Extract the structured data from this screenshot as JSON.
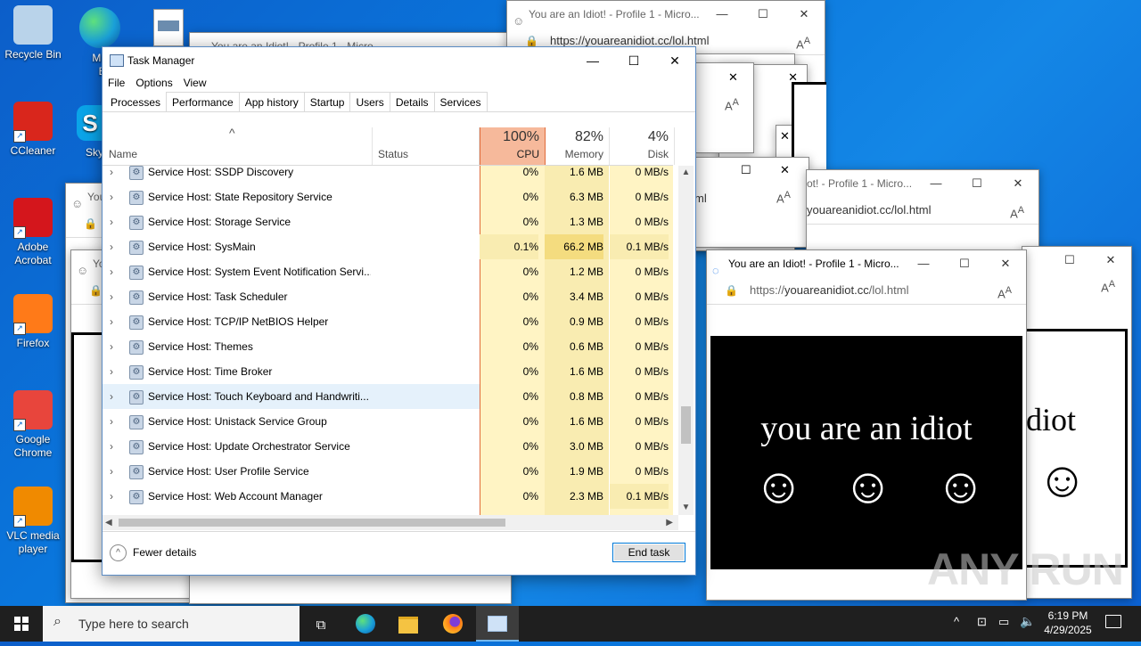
{
  "desktop": {
    "icons": [
      {
        "label": "Recycle Bin",
        "icon": "recycle-bin-icon",
        "color": "#b9d3ea"
      },
      {
        "label": "CCleaner",
        "icon": "ccleaner-icon",
        "color": "#d9261c"
      },
      {
        "label": "Adobe Acrobat",
        "icon": "adobe-acrobat-icon",
        "color": "#d4161c"
      },
      {
        "label": "Firefox",
        "icon": "firefox-icon",
        "color": "#ff7a18"
      },
      {
        "label": "Google Chrome",
        "icon": "chrome-icon",
        "color": "#e8453c"
      },
      {
        "label": "VLC media player",
        "icon": "vlc-icon",
        "color": "#f08a00"
      }
    ],
    "partial_icons": [
      {
        "label": "Micro Ed",
        "icon": "edge-icon"
      },
      {
        "label": "Sky",
        "icon": "skype-icon"
      }
    ]
  },
  "browser": {
    "title": "You are an Idiot! - Profile 1 - Micro...",
    "title_short": "You are an Idiot! - Profile 1 - Micro",
    "title_tail": "ot! - Profile 1 - Micro...",
    "url_prefix": "https://",
    "url_host": "youareanidiot.cc",
    "url_path": "/lol.html",
    "url_tail": "youareanidiot.cc/lol.html",
    "url_small": "ml",
    "heading": "you are an idiot",
    "heading_partial": "diot",
    "smiley": "☺"
  },
  "task_manager": {
    "title": "Task Manager",
    "menu": [
      "File",
      "Options",
      "View"
    ],
    "tabs": [
      "Processes",
      "Performance",
      "App history",
      "Startup",
      "Users",
      "Details",
      "Services"
    ],
    "active_tab": "Processes",
    "columns": {
      "name": "Name",
      "status": "Status",
      "cpu": {
        "pct": "100%",
        "label": "CPU"
      },
      "memory": {
        "pct": "82%",
        "label": "Memory"
      },
      "disk": {
        "pct": "4%",
        "label": "Disk"
      }
    },
    "rows": [
      {
        "name": "Service Host: SSDP Discovery",
        "cpu": "0%",
        "mem": "1.6 MB",
        "disk": "0 MB/s"
      },
      {
        "name": "Service Host: State Repository Service",
        "cpu": "0%",
        "mem": "6.3 MB",
        "disk": "0 MB/s"
      },
      {
        "name": "Service Host: Storage Service",
        "cpu": "0%",
        "mem": "1.3 MB",
        "disk": "0 MB/s"
      },
      {
        "name": "Service Host: SysMain",
        "cpu": "0.1%",
        "mem": "66.2 MB",
        "disk": "0.1 MB/s"
      },
      {
        "name": "Service Host: System Event Notification Servi...",
        "cpu": "0%",
        "mem": "1.2 MB",
        "disk": "0 MB/s"
      },
      {
        "name": "Service Host: Task Scheduler",
        "cpu": "0%",
        "mem": "3.4 MB",
        "disk": "0 MB/s"
      },
      {
        "name": "Service Host: TCP/IP NetBIOS Helper",
        "cpu": "0%",
        "mem": "0.9 MB",
        "disk": "0 MB/s"
      },
      {
        "name": "Service Host: Themes",
        "cpu": "0%",
        "mem": "0.6 MB",
        "disk": "0 MB/s"
      },
      {
        "name": "Service Host: Time Broker",
        "cpu": "0%",
        "mem": "1.6 MB",
        "disk": "0 MB/s"
      },
      {
        "name": "Service Host: Touch Keyboard and Handwriti...",
        "cpu": "0%",
        "mem": "0.8 MB",
        "disk": "0 MB/s"
      },
      {
        "name": "Service Host: Unistack Service Group",
        "cpu": "0%",
        "mem": "1.6 MB",
        "disk": "0 MB/s"
      },
      {
        "name": "Service Host: Update Orchestrator Service",
        "cpu": "0%",
        "mem": "3.0 MB",
        "disk": "0 MB/s"
      },
      {
        "name": "Service Host: User Profile Service",
        "cpu": "0%",
        "mem": "1.9 MB",
        "disk": "0 MB/s"
      },
      {
        "name": "Service Host: Web Account Manager",
        "cpu": "0%",
        "mem": "2.3 MB",
        "disk": "0.1 MB/s"
      }
    ],
    "selected_row": 9,
    "fewer_details": "Fewer details",
    "end_task": "End task"
  },
  "taskbar": {
    "search_placeholder": "Type here to search",
    "time": "6:19 PM",
    "date": "4/29/2025"
  },
  "watermark": "ANY RUN",
  "colors": {
    "cpu_header": "#f6b99b",
    "cpu_cell": "#fff4c4",
    "mem_cell": "#f9ecb1",
    "selected_row": "#e5f1fb",
    "accent": "#0078d7"
  }
}
